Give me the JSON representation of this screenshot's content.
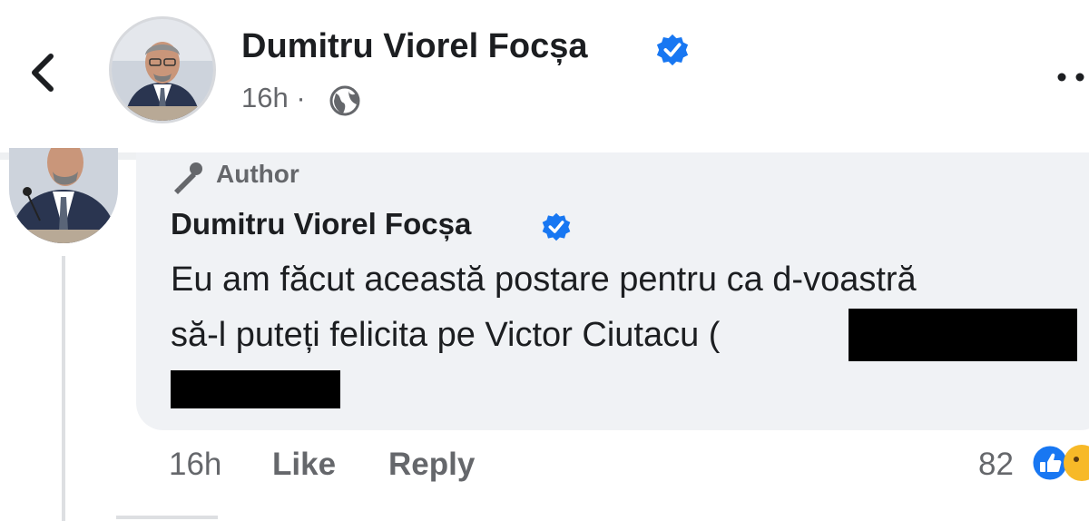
{
  "post_header": {
    "author_name": "Dumitru Viorel Focșa",
    "time": "16h",
    "separator": "·",
    "privacy_icon": "globe-icon",
    "verified_icon": "verified-badge-icon",
    "back_icon": "chevron-left-icon",
    "more_icon": "more-options-icon"
  },
  "comment": {
    "badge_label": "Author",
    "badge_icon": "megaphone-icon",
    "author_name": "Dumitru Viorel Focșa",
    "text_line1": "Eu am făcut această postare pentru ca d-voastră",
    "text_line2": "să-l puteți felicita pe Victor Ciutacu (",
    "time": "16h",
    "like_label": "Like",
    "reply_label": "Reply",
    "reaction_count": "82",
    "reaction_icon": "like-reaction-icon"
  },
  "colors": {
    "verified_blue": "#1877f2",
    "secondary_text": "#65676b",
    "bubble_bg": "#f0f2f5",
    "redaction": "#000000"
  }
}
